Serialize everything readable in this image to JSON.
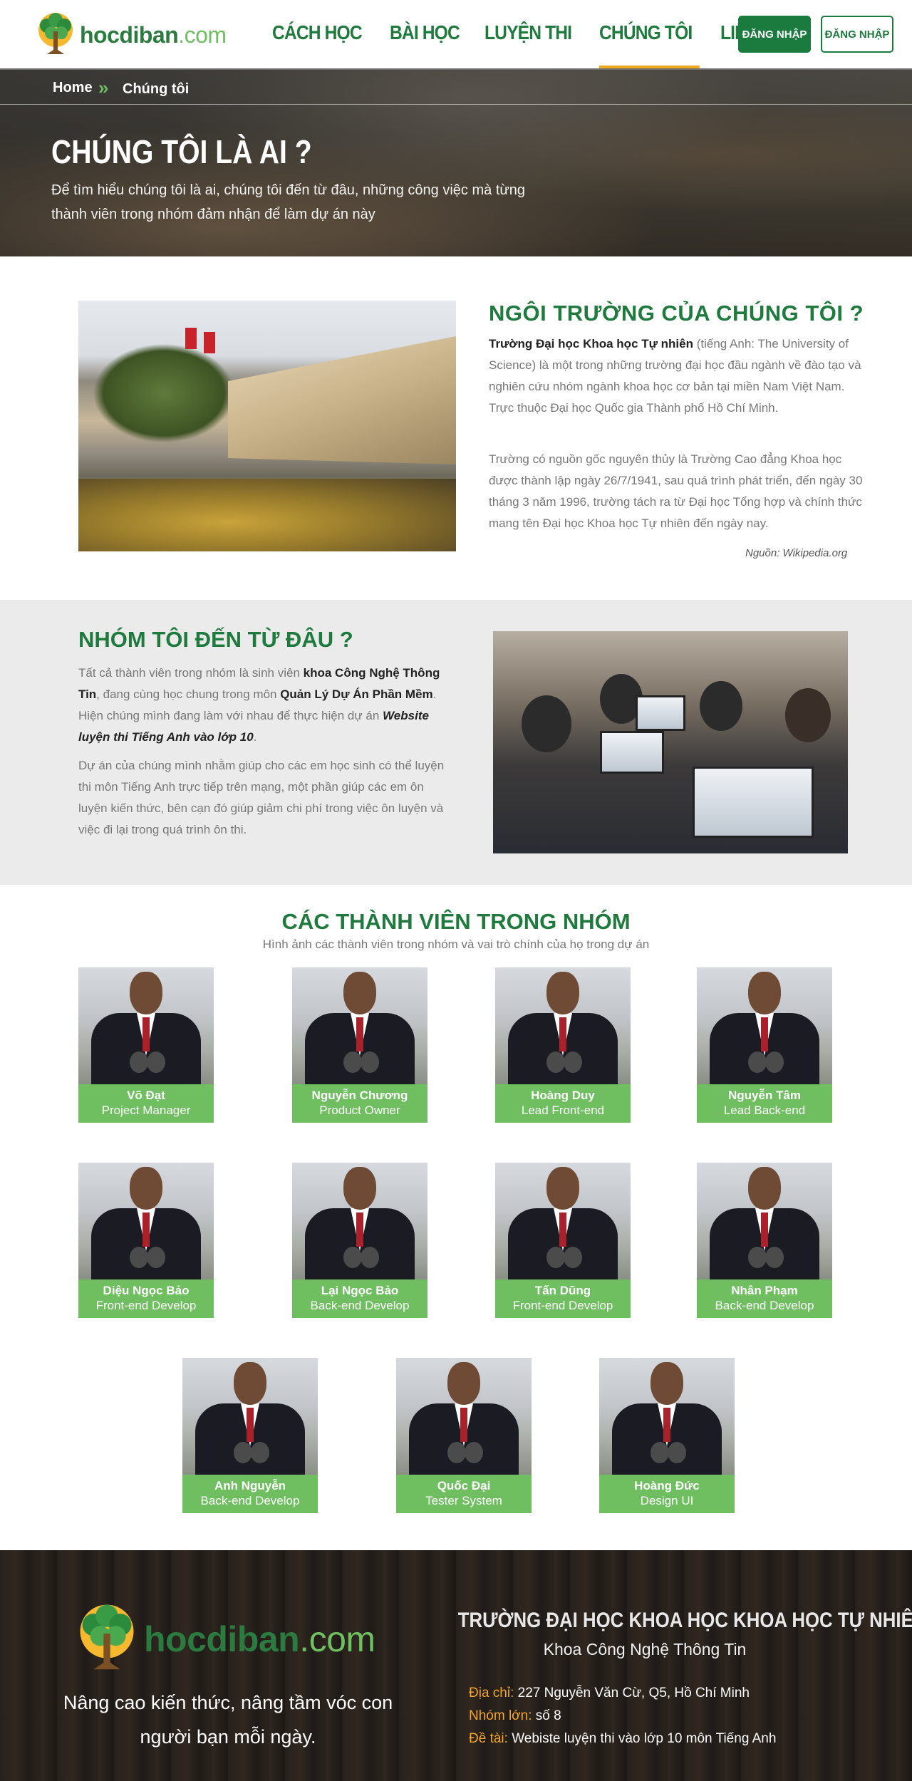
{
  "header": {
    "logo_main": "hocdiban",
    "logo_suffix": ".com",
    "nav": [
      "CÁCH HỌC",
      "BÀI HỌC",
      "LUYỆN THI",
      "CHÚNG TÔI",
      "LIÊN HỆ"
    ],
    "register_label": "ĐĂNG NHẬP",
    "login_label": "ĐĂNG NHẬP"
  },
  "breadcrumb": {
    "home": "Home",
    "separator": "»",
    "current": "Chúng tôi"
  },
  "hero": {
    "title": "CHÚNG TÔI LÀ AI ?",
    "desc": "Để tìm hiểu chúng tôi là ai, chúng tôi đến từ đâu, những công việc mà từng thành viên trong nhóm đảm nhận để làm dự án này"
  },
  "school": {
    "title": "NGÔI TRƯỜNG CỦA CHÚNG TÔI ?",
    "p1_bold": "Trường Đại học Khoa học Tự nhiên",
    "p1_rest": " (tiếng Anh: The University of Science) là một trong những trường đại học đầu ngành về đào tạo và nghiên cứu nhóm ngành khoa học cơ bản tại miền Nam Việt Nam. Trực thuộc Đại học Quốc gia Thành phố Hồ Chí Minh.",
    "p2": "Trường có nguồn gốc nguyên thủy là Trường Cao đẳng Khoa học được thành lập ngày 26/7/1941, sau quá trình phát triển, đến ngày 30 tháng 3 năm 1996, trường tách ra từ Đại học Tổng hợp và chính thức mang tên Đại học Khoa học Tự nhiên đến ngày nay.",
    "source": "Nguồn: Wikipedia.org"
  },
  "origin": {
    "title": "NHÓM TÔI ĐẾN TỪ ĐÂU ?",
    "p1_a": "Tất cả thành viên trong nhóm là sinh viên ",
    "p1_b": "khoa Công Nghệ Thông Tin",
    "p1_c": ", đang cùng học chung trong môn ",
    "p1_d": "Quản Lý Dự Án Phần Mềm",
    "p1_e": ". Hiện chúng mình đang làm với nhau để thực hiện dự án ",
    "p1_f": "Website luyện thi Tiếng Anh vào lớp 10",
    "p1_g": ".",
    "p2": "Dự án của chúng mình nhằm giúp cho các em học sinh có thể luyện thi môn Tiếng Anh trực tiếp trên mạng, một phần giúp các em ôn luyện kiến thức, bên cạn đó giúp giảm chi phí trong việc ôn luyện và việc đi lại trong quá trình ôn thi."
  },
  "members": {
    "title": "CÁC THÀNH VIÊN TRONG NHÓM",
    "subtitle": "Hình ảnh các thành viên trong nhóm và vai trò chính của họ trong dự án",
    "list": [
      {
        "name": "Võ Đạt",
        "role": "Project Manager"
      },
      {
        "name": "Nguyễn Chương",
        "role": "Product Owner"
      },
      {
        "name": "Hoàng Duy",
        "role": "Lead Front-end"
      },
      {
        "name": "Nguyễn Tâm",
        "role": "Lead Back-end"
      },
      {
        "name": "Diệu Ngọc Bảo",
        "role": "Front-end Develop"
      },
      {
        "name": "Lại Ngọc Bảo",
        "role": "Back-end Develop"
      },
      {
        "name": "Tấn Dũng",
        "role": "Front-end Develop"
      },
      {
        "name": "Nhân Phạm",
        "role": "Back-end Develop"
      },
      {
        "name": "Anh Nguyễn",
        "role": "Back-end Develop"
      },
      {
        "name": "Quốc Đại",
        "role": "Tester System"
      },
      {
        "name": "Hoàng Đức",
        "role": "Design UI"
      }
    ]
  },
  "footer": {
    "logo_main": "hocdiban",
    "logo_suffix": ".com",
    "slogan": "Nâng cao kiến thức, nâng tầm vóc con người bạn mỗi ngày.",
    "school": "TRƯỜNG ĐẠI HỌC KHOA HỌC KHOA HỌC TỰ NHIÊN",
    "faculty": "Khoa Công Nghệ Thông Tin",
    "address_key": "Địa chỉ:",
    "address_val": " 227 Nguyễn Văn Cừ, Q5, Hồ Chí Minh",
    "group_key": "Nhóm lớn:",
    "group_val": " số 8",
    "topic_key": "Đề tài:",
    "topic_val": " Webiste luyện thi vào lớp 10 môn Tiếng Anh"
  },
  "colors": {
    "brand_green": "#1e7a3d",
    "label_green": "#6fbf61",
    "accent_orange": "#f0a81c"
  }
}
